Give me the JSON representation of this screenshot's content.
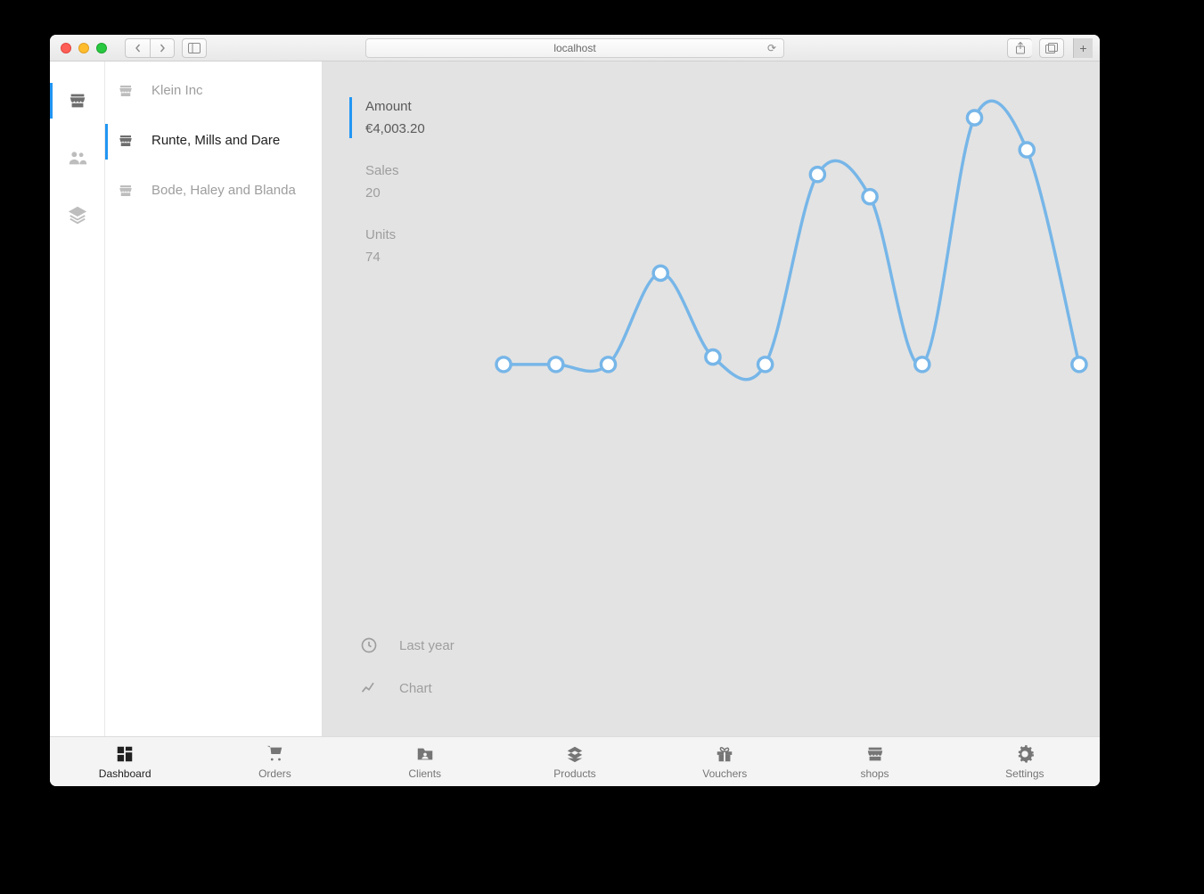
{
  "browser": {
    "address": "localhost"
  },
  "minisidebar": {
    "items": [
      {
        "icon": "store-icon",
        "active": true
      },
      {
        "icon": "people-icon",
        "active": false
      },
      {
        "icon": "layers-icon",
        "active": false
      }
    ]
  },
  "list": {
    "items": [
      {
        "label": "Klein Inc",
        "active": false
      },
      {
        "label": "Runte, Mills and Dare",
        "active": true
      },
      {
        "label": "Bode, Haley and Blanda",
        "active": false
      }
    ]
  },
  "metrics": [
    {
      "label": "Amount",
      "value": "€4,003.20",
      "active": true
    },
    {
      "label": "Sales",
      "value": "20",
      "active": false
    },
    {
      "label": "Units",
      "value": "74",
      "active": false
    }
  ],
  "controls": {
    "period": "Last year",
    "view": "Chart"
  },
  "bottomnav": [
    {
      "label": "Dashboard",
      "icon": "dashboard-icon",
      "active": true
    },
    {
      "label": "Orders",
      "icon": "cart-icon",
      "active": false
    },
    {
      "label": "Clients",
      "icon": "folder-person-icon",
      "active": false
    },
    {
      "label": "Products",
      "icon": "layers-icon",
      "active": false
    },
    {
      "label": "Vouchers",
      "icon": "gift-icon",
      "active": false
    },
    {
      "label": "shops",
      "icon": "store-icon",
      "active": false
    },
    {
      "label": "Settings",
      "icon": "gear-icon",
      "active": false
    }
  ],
  "chart_data": {
    "type": "line",
    "x": [
      1,
      2,
      3,
      4,
      5,
      6,
      7,
      8,
      9,
      10,
      11,
      12
    ],
    "values": [
      0,
      0,
      0,
      370,
      30,
      0,
      770,
      680,
      0,
      1000,
      870,
      0
    ],
    "ylim": [
      0,
      1000
    ],
    "stroke": "#77b6e8",
    "point_fill": "#ffffff"
  }
}
